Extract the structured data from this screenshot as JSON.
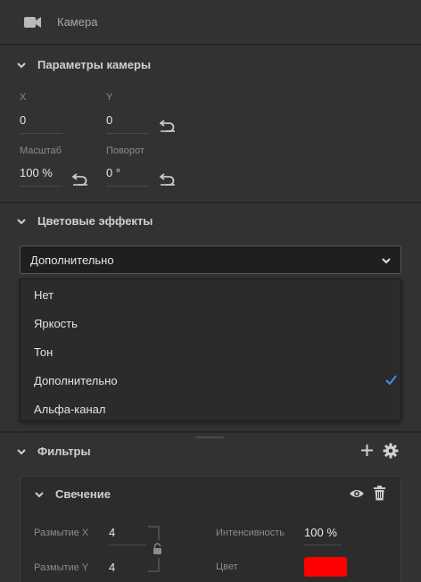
{
  "header": {
    "title": "Камера",
    "icon": "camera-icon"
  },
  "camera_params": {
    "title": "Параметры камеры",
    "x_label": "X",
    "x_value": "0",
    "y_label": "Y",
    "y_value": "0",
    "scale_label": "Масштаб",
    "scale_value": "100 %",
    "rotation_label": "Поворот",
    "rotation_value": "0 °"
  },
  "color_effects": {
    "title": "Цветовые эффекты",
    "selected": "Дополнительно",
    "options": [
      {
        "label": "Нет",
        "checked": false
      },
      {
        "label": "Яркость",
        "checked": false
      },
      {
        "label": "Тон",
        "checked": false
      },
      {
        "label": "Дополнительно",
        "checked": true
      },
      {
        "label": "Альфа-канал",
        "checked": false
      }
    ],
    "check_color": "#3b8fe6"
  },
  "filters": {
    "title": "Фильтры",
    "glow": {
      "title": "Свечение",
      "blur_x_label": "Размытие X",
      "blur_x_value": "4",
      "blur_y_label": "Размытие Y",
      "blur_y_value": "4",
      "intensity_label": "Интенсивность",
      "intensity_value": "100",
      "intensity_unit": "%",
      "color_label": "Цвет",
      "color_value": "#ff0000"
    }
  }
}
